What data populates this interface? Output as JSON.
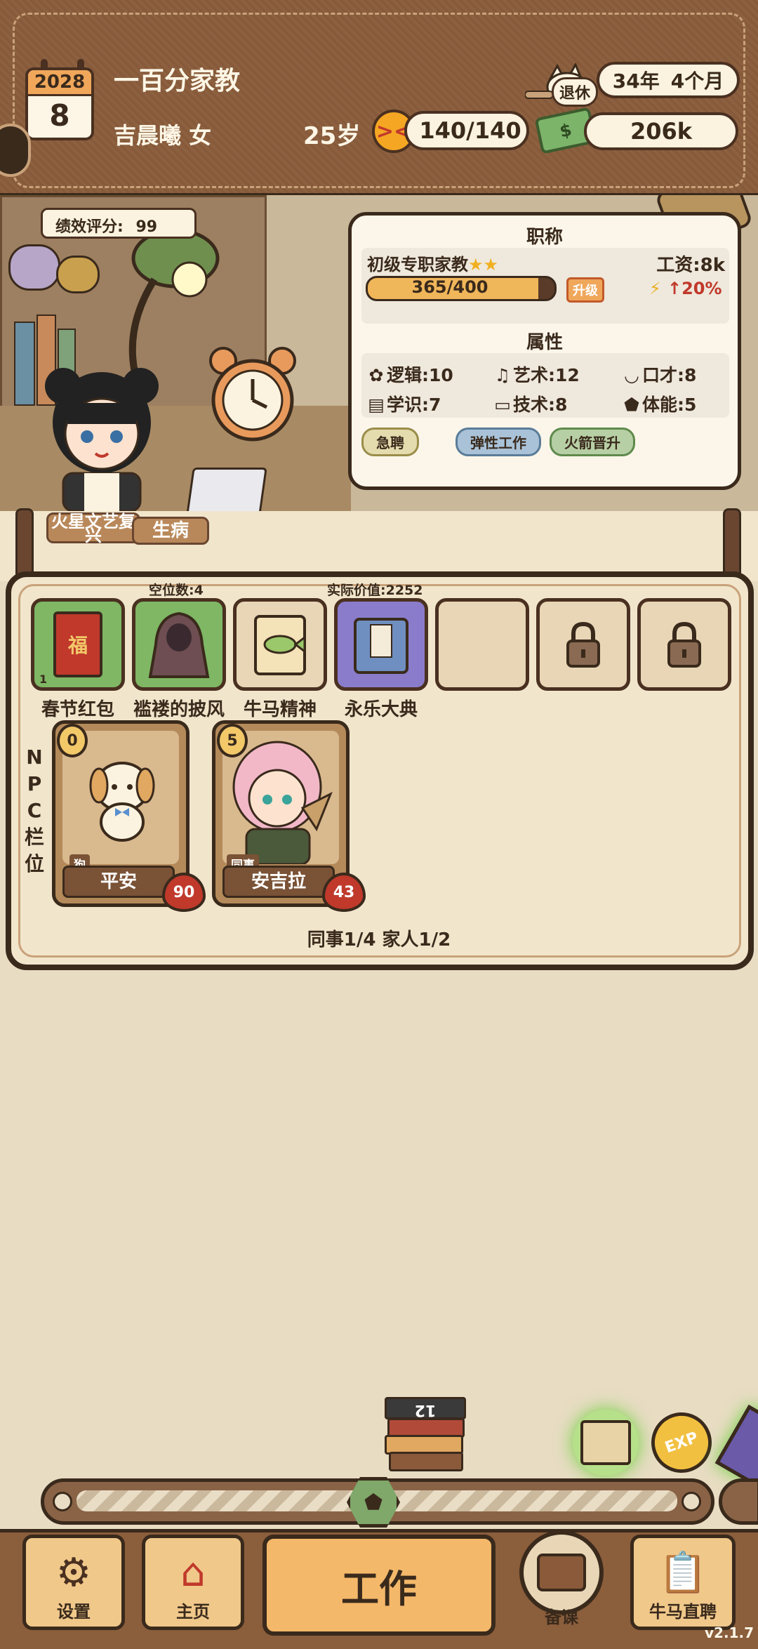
{
  "header": {
    "calendar_year": "2028",
    "calendar_month": "8",
    "job_title": "一百分家教",
    "character_name": "吉晨曦 女",
    "age": "25岁",
    "stamina": "140/140",
    "retire_label": "退休",
    "retire_years": "34年",
    "retire_months": "4个月",
    "money": "206k"
  },
  "scene": {
    "score_label": "绩效评分:",
    "score_value": "99"
  },
  "profession": {
    "section_title": "职称",
    "rank": "初级专职家教",
    "stars": "★★",
    "salary": "工资:8k",
    "xp_text": "365/400",
    "xp_fraction": 0.9125,
    "upgrade_label": "升级",
    "bonus": "↑20%"
  },
  "attributes": {
    "section_title": "属性",
    "logic": "逻辑:10",
    "art": "艺术:12",
    "eloquence": "口才:8",
    "knowledge": "学识:7",
    "tech": "技术:8",
    "stamina": "体能:5"
  },
  "tags": [
    "急聘",
    "弹性工作",
    "火箭晋升"
  ],
  "events": {
    "event1": "火星文艺复兴",
    "event2": "生病"
  },
  "inventory": {
    "empty_slots": "空位数:4",
    "real_value": "实际价值:2252",
    "item_count": "1",
    "items": [
      "春节红包",
      "褴褛的披风",
      "牛马精神",
      "永乐大典"
    ]
  },
  "npc": {
    "side_label": [
      "N",
      "P",
      "C",
      "栏",
      "位"
    ],
    "cards": [
      {
        "name": "平安",
        "role": "狗",
        "level": "0",
        "affinity": "90"
      },
      {
        "name": "安吉拉",
        "role": "同事",
        "level": "5",
        "affinity": "43"
      }
    ],
    "footer": "同事1/4 家人1/2"
  },
  "bottom": {
    "book_count": "12",
    "exp_label": "EXP",
    "nav": {
      "settings": "设置",
      "home": "主页",
      "work": "工作",
      "prepare": "备课",
      "hire": "牛马直聘"
    },
    "version": "v2.1.7"
  },
  "colors": {
    "wood": "#8b5e3c",
    "outline": "#3a2a1c",
    "parchment": "#f1e6cc",
    "accent_orange": "#f0a75a",
    "bonus_red": "#c0392b"
  }
}
